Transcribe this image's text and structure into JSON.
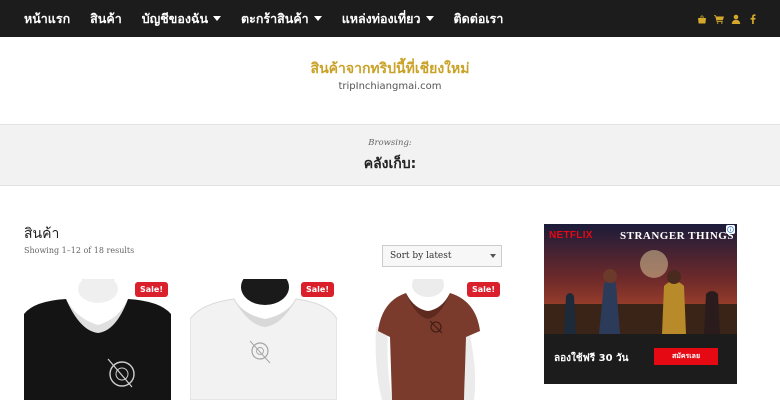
{
  "nav": {
    "items": [
      {
        "label": "หน้าแรก",
        "has_dropdown": false
      },
      {
        "label": "สินค้า",
        "has_dropdown": false
      },
      {
        "label": "บัญชีของฉัน",
        "has_dropdown": true
      },
      {
        "label": "ตะกร้าสินค้า",
        "has_dropdown": true
      },
      {
        "label": "แหล่งท่องเที่ยว",
        "has_dropdown": true
      },
      {
        "label": "ติดต่อเรา",
        "has_dropdown": false
      }
    ],
    "icons": [
      "shopping-bag-icon",
      "cart-icon",
      "user-icon",
      "facebook-icon"
    ],
    "background_color": "#1c1c1c",
    "icon_color": "#d4a82a"
  },
  "site": {
    "title": "สินค้าจากทริปนี้ที่เชียงใหม่",
    "subtitle": "tripInchiangmai.com",
    "title_color": "#c9a227"
  },
  "browsing": {
    "label": "Browsing:",
    "title": "คลังเก็บ:"
  },
  "shop": {
    "heading": "สินค้า",
    "results": "Showing 1–12 of 18 results",
    "sort": {
      "selected": "Sort by latest"
    }
  },
  "products": [
    {
      "badge": "Sale!",
      "shirt_color": "#141414",
      "image": "black-v-neck-shirt"
    },
    {
      "badge": "Sale!",
      "shirt_color": "#f2f2f2",
      "image": "white-v-neck-shirt"
    },
    {
      "badge": "Sale!",
      "shirt_color": "#7a3a2c",
      "image": "brown-v-neck-shirt"
    }
  ],
  "ad": {
    "brand": "NETFLIX",
    "title": "STRANGER THINGS",
    "offer": "ลองใช้ฟรี 30 วัน",
    "cta": "สมัครเลย",
    "accent_color": "#e50914"
  },
  "badge_color": "#d9202b"
}
